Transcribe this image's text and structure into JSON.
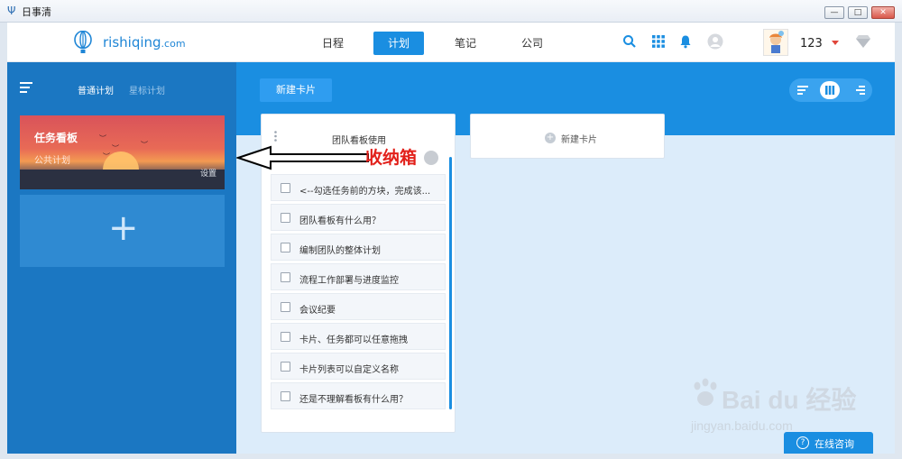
{
  "window": {
    "title": "日事清",
    "minimize_label": "—",
    "maximize_label": "□",
    "close_label": "✕"
  },
  "nav": {
    "logo_text": "rishiqing",
    "logo_suffix": ".com",
    "tabs": [
      {
        "label": "日程",
        "active": false
      },
      {
        "label": "计划",
        "active": true
      },
      {
        "label": "笔记",
        "active": false
      },
      {
        "label": "公司",
        "active": false
      }
    ],
    "icons": [
      "search-icon",
      "apps-grid-icon",
      "bell-icon",
      "user-circle-icon"
    ],
    "user_name": "123",
    "accent_color": "#1a8ee1"
  },
  "sidebar": {
    "tabs": [
      {
        "label": "普通计划",
        "active": true
      },
      {
        "label": "星标计划",
        "active": false
      }
    ],
    "plan_card": {
      "title": "任务看板",
      "subtitle": "公共计划",
      "settings_label": "设置"
    },
    "add_label": "+"
  },
  "board": {
    "new_card_label": "新建卡片",
    "view_modes": [
      "list-view-icon",
      "kanban-view-icon",
      "gantt-view-icon"
    ],
    "active_view": "kanban-view-icon",
    "column": {
      "title": "团队看板使用",
      "tasks": [
        {
          "text": "<--勾选任务前的方块，完成该..."
        },
        {
          "text": "团队看板有什么用？"
        },
        {
          "text": "编制团队的整体计划"
        },
        {
          "text": "流程工作部署与进度监控"
        },
        {
          "text": "会议纪要"
        },
        {
          "text": "卡片、任务都可以任意拖拽"
        },
        {
          "text": "卡片列表可以自定义名称"
        },
        {
          "text": "还是不理解看板有什么用？"
        }
      ]
    },
    "add_column_label": "新建卡片"
  },
  "annotation": {
    "label": "收纳箱",
    "color": "#e2201a"
  },
  "watermark": {
    "main": "Bai du 经验",
    "sub": "jingyan.baidu.com"
  },
  "online_help": {
    "label": "在线咨询"
  }
}
